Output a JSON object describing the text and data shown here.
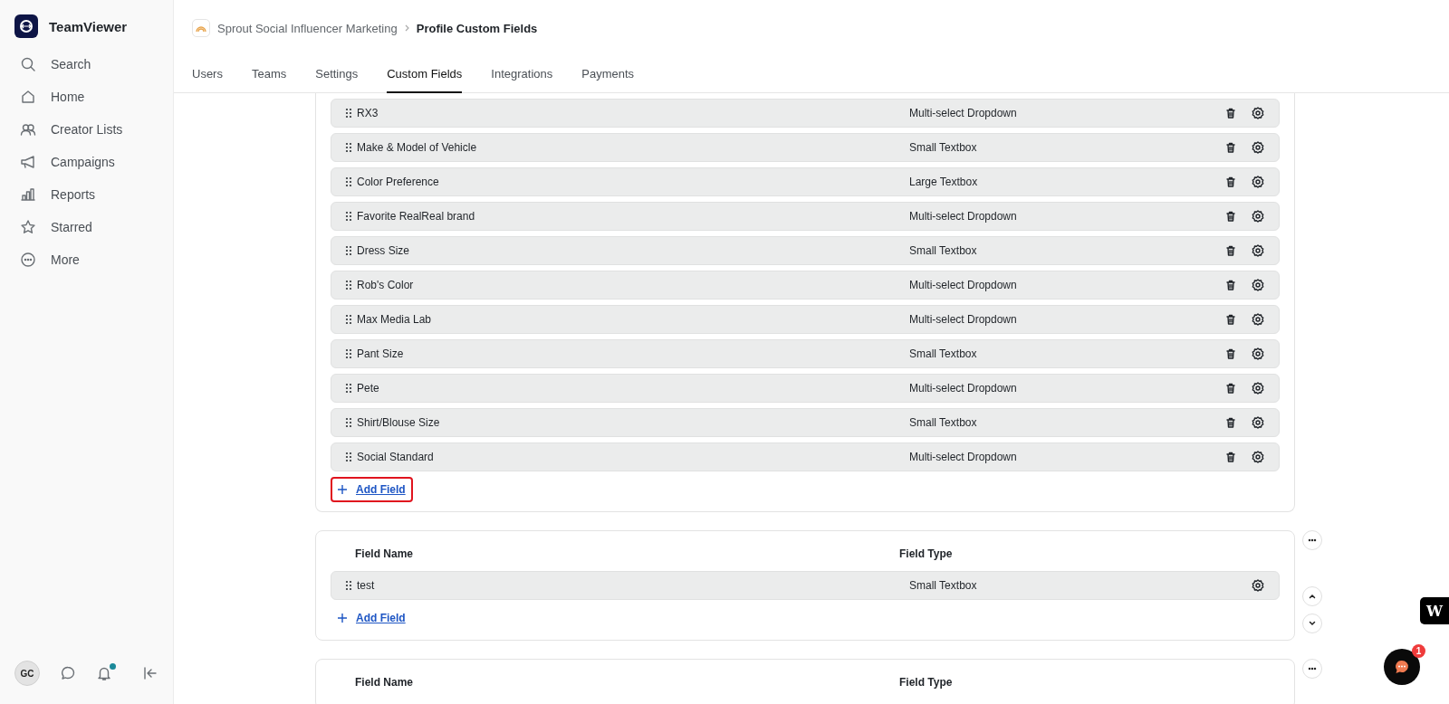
{
  "sidebar": {
    "brand": "TeamViewer",
    "items": [
      {
        "label": "Search"
      },
      {
        "label": "Home"
      },
      {
        "label": "Creator Lists"
      },
      {
        "label": "Campaigns"
      },
      {
        "label": "Reports"
      },
      {
        "label": "Starred"
      },
      {
        "label": "More"
      }
    ],
    "avatar": "GC",
    "notification_badge": true
  },
  "breadcrumb": {
    "parent": "Sprout Social Influencer Marketing",
    "current": "Profile Custom Fields"
  },
  "tabs": [
    {
      "label": "Users",
      "selected": false
    },
    {
      "label": "Teams",
      "selected": false
    },
    {
      "label": "Settings",
      "selected": false
    },
    {
      "label": "Custom Fields",
      "selected": true
    },
    {
      "label": "Integrations",
      "selected": false
    },
    {
      "label": "Payments",
      "selected": false
    }
  ],
  "cards": [
    {
      "more_menu": false,
      "reorder_controls": false,
      "add_label": "Add Field",
      "add_highlighted": true,
      "rows": [
        {
          "name": "RX3",
          "type": "Multi-select Dropdown",
          "deletable": true
        },
        {
          "name": "Make & Model of Vehicle",
          "type": "Small Textbox",
          "deletable": true
        },
        {
          "name": "Color Preference",
          "type": "Large Textbox",
          "deletable": true
        },
        {
          "name": "Favorite RealReal brand",
          "type": "Multi-select Dropdown",
          "deletable": true
        },
        {
          "name": "Dress Size",
          "type": "Small Textbox",
          "deletable": true
        },
        {
          "name": "Rob's Color",
          "type": "Multi-select Dropdown",
          "deletable": true
        },
        {
          "name": "Max Media Lab",
          "type": "Multi-select Dropdown",
          "deletable": true
        },
        {
          "name": "Pant Size",
          "type": "Small Textbox",
          "deletable": true
        },
        {
          "name": "Pete",
          "type": "Multi-select Dropdown",
          "deletable": true
        },
        {
          "name": "Shirt/Blouse Size",
          "type": "Small Textbox",
          "deletable": true
        },
        {
          "name": "Social Standard",
          "type": "Multi-select Dropdown",
          "deletable": true
        }
      ]
    },
    {
      "header": {
        "column_1": "Field Name",
        "column_2": "Field Type"
      },
      "more_menu": true,
      "reorder_controls": true,
      "add_label": "Add Field",
      "add_highlighted": false,
      "rows": [
        {
          "name": "test",
          "type": "Small Textbox",
          "deletable": false
        }
      ]
    },
    {
      "header": {
        "column_1": "Field Name",
        "column_2": "Field Type"
      },
      "more_menu": true,
      "reorder_controls": false
    }
  ],
  "floating": {
    "logo": "W",
    "chat_badge": "1"
  }
}
